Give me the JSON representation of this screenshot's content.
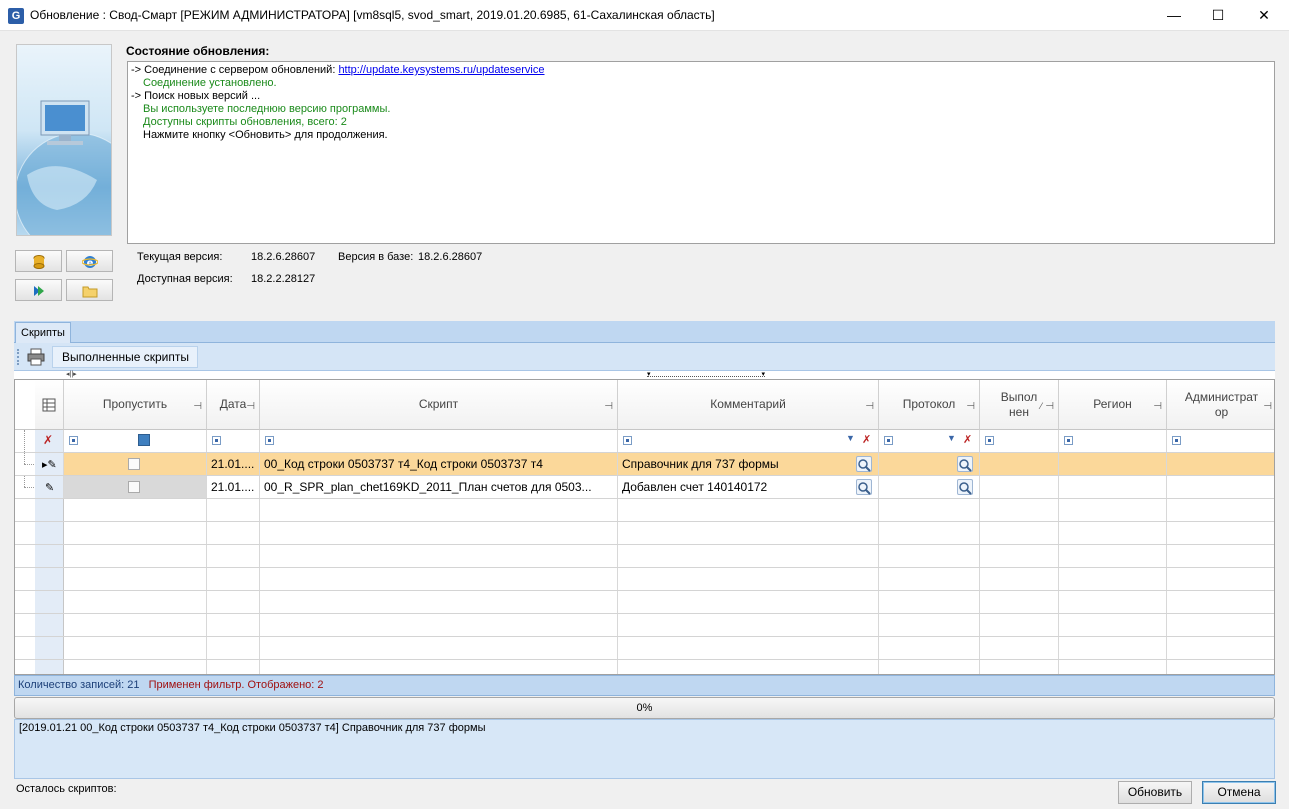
{
  "window": {
    "title": "Обновление : Свод-Смарт [РЕЖИМ АДМИНИСТРАТОРА] [vm8sql5, svod_smart, 2019.01.20.6985, 61-Сахалинская область]",
    "minimize": "—",
    "maximize": "☐",
    "close": "✕"
  },
  "status": {
    "label": "Состояние обновления:",
    "log": [
      {
        "prefix": "-> Соединение с сервером обновлений: ",
        "link": "http://update.keysystems.ru/updateservice",
        "style": "black"
      },
      {
        "text": "Соединение установлено.",
        "style": "green"
      },
      {
        "text": "-> Поиск новых версий ...",
        "style": "black"
      },
      {
        "text": "Вы используете последнюю версию программы.",
        "style": "green"
      },
      {
        "text": "Доступны скрипты обновления, всего: 2",
        "style": "green"
      },
      {
        "text": "Нажмите кнопку <Обновить> для продолжения.",
        "style": "black-ind"
      }
    ]
  },
  "versions": {
    "current_label": "Текущая версия:",
    "current_value": "18.2.6.28607",
    "db_label": "Версия в базе:",
    "db_value": "18.2.6.28607",
    "available_label": "Доступная версия:",
    "available_value": "18.2.2.28127"
  },
  "side_buttons": [
    "database-icon",
    "internet-explorer-icon",
    "keysystems-icon",
    "folder-icon"
  ],
  "tabs": {
    "scripts": "Скрипты"
  },
  "toolbar": {
    "done_scripts": "Выполненные скрипты"
  },
  "grid": {
    "columns": {
      "skip": "Пропустить",
      "date": "Дата",
      "script": "Скрипт",
      "comment": "Комментарий",
      "protocol": "Протокол",
      "done_1": "Выпол",
      "done_2": "нен",
      "region": "Регион",
      "admin_1": "Администрат",
      "admin_2": "ор"
    },
    "rows": [
      {
        "date": "21.01....",
        "script": "00_Код строки 0503737 т4_Код строки 0503737 т4",
        "comment": "Справочник для 737 формы",
        "selected": true
      },
      {
        "date": "21.01....",
        "script": "00_R_SPR_plan_chet169KD_2011_План  счетов  для  0503...",
        "comment": "Добавлен счет 140140172",
        "selected": false
      }
    ]
  },
  "footer": {
    "count": "Количество записей: 21",
    "filter": "Применен фильтр. Отображено: 2",
    "progress": "0%",
    "progress_fraction": 0,
    "message": "[2019.01.21 00_Код строки 0503737 т4_Код строки 0503737 т4] Справочник для 737 формы",
    "remaining": "Осталось скриптов:",
    "update_button": "Обновить",
    "cancel_button": "Отмена"
  },
  "colors": {
    "selected_row": "#fbd89a",
    "status_green": "#1a8a1a",
    "filter_red": "#a01010",
    "panel_blue": "#bfd7f1"
  }
}
